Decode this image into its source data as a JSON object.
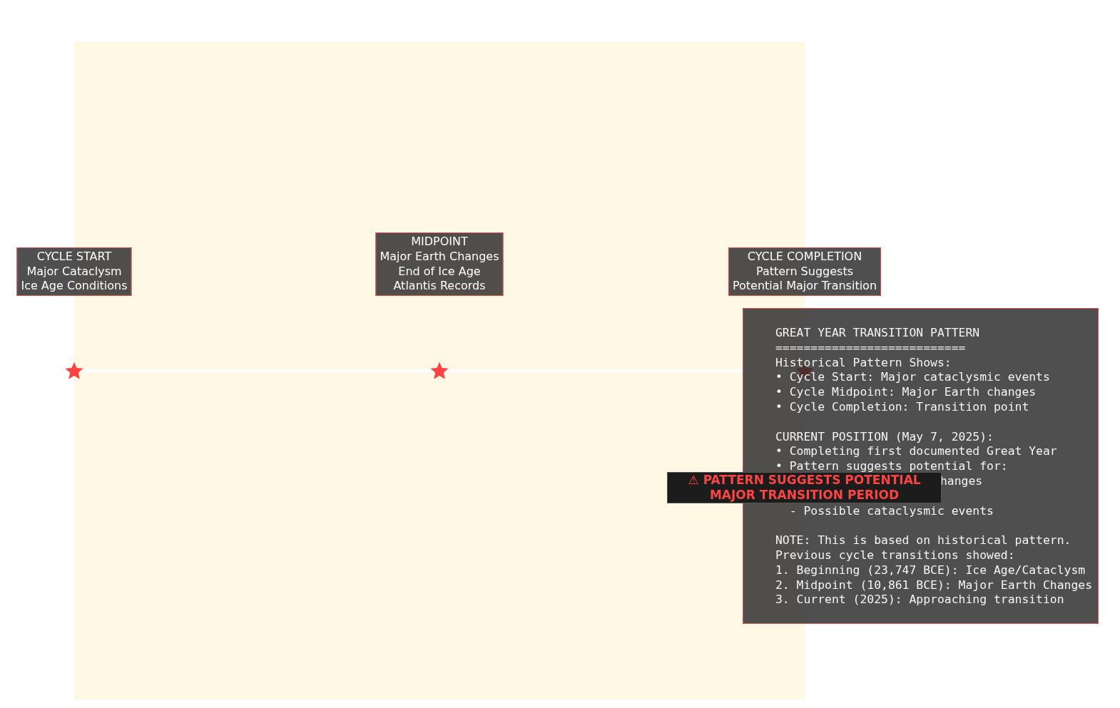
{
  "timeline": {
    "events": [
      {
        "lines": [
          "CYCLE START",
          "Major Cataclysm",
          "Ice Age Conditions"
        ]
      },
      {
        "lines": [
          "MIDPOINT",
          "Major Earth Changes",
          "End of Ice Age",
          "Atlantis Records"
        ]
      },
      {
        "lines": [
          "CYCLE COMPLETION",
          "Pattern Suggests",
          "Potential Major Transition"
        ]
      }
    ]
  },
  "info_panel": {
    "paragraphs": [
      [
        {
          "kind": "line",
          "text": "GREAT YEAR TRANSITION PATTERN"
        },
        {
          "kind": "line",
          "text": "==========================="
        },
        {
          "kind": "line",
          "text": "Historical Pattern Shows:"
        },
        {
          "kind": "line",
          "text": "• Cycle Start: Major cataclysmic events"
        },
        {
          "kind": "line",
          "text": "• Cycle Midpoint: Major Earth changes"
        },
        {
          "kind": "line",
          "text": "• Cycle Completion: Transition point"
        }
      ],
      [
        {
          "kind": "line",
          "text": "CURRENT POSITION (May 7, 2025):"
        },
        {
          "kind": "line",
          "text": "• Completing first documented Great Year"
        },
        {
          "kind": "line",
          "text": "• Pattern suggests potential for:"
        },
        {
          "kind": "tail",
          "text": "hanges"
        },
        {
          "kind": "covered"
        },
        {
          "kind": "line",
          "text": "  - Possible cataclysmic events"
        }
      ],
      [
        {
          "kind": "line",
          "text": "NOTE: This is based on historical pattern."
        },
        {
          "kind": "line",
          "text": "Previous cycle transitions showed:"
        },
        {
          "kind": "line",
          "text": "1. Beginning (23,747 BCE): Ice Age/Cataclysm"
        },
        {
          "kind": "line",
          "text": "2. Midpoint (10,861 BCE): Major Earth Changes"
        },
        {
          "kind": "line",
          "text": "3. Current (2025): Approaching transition"
        }
      ]
    ]
  },
  "warning": {
    "icon": "⚠",
    "lines": [
      "PATTERN SUGGESTS POTENTIAL",
      "MAJOR TRANSITION PERIOD"
    ]
  }
}
